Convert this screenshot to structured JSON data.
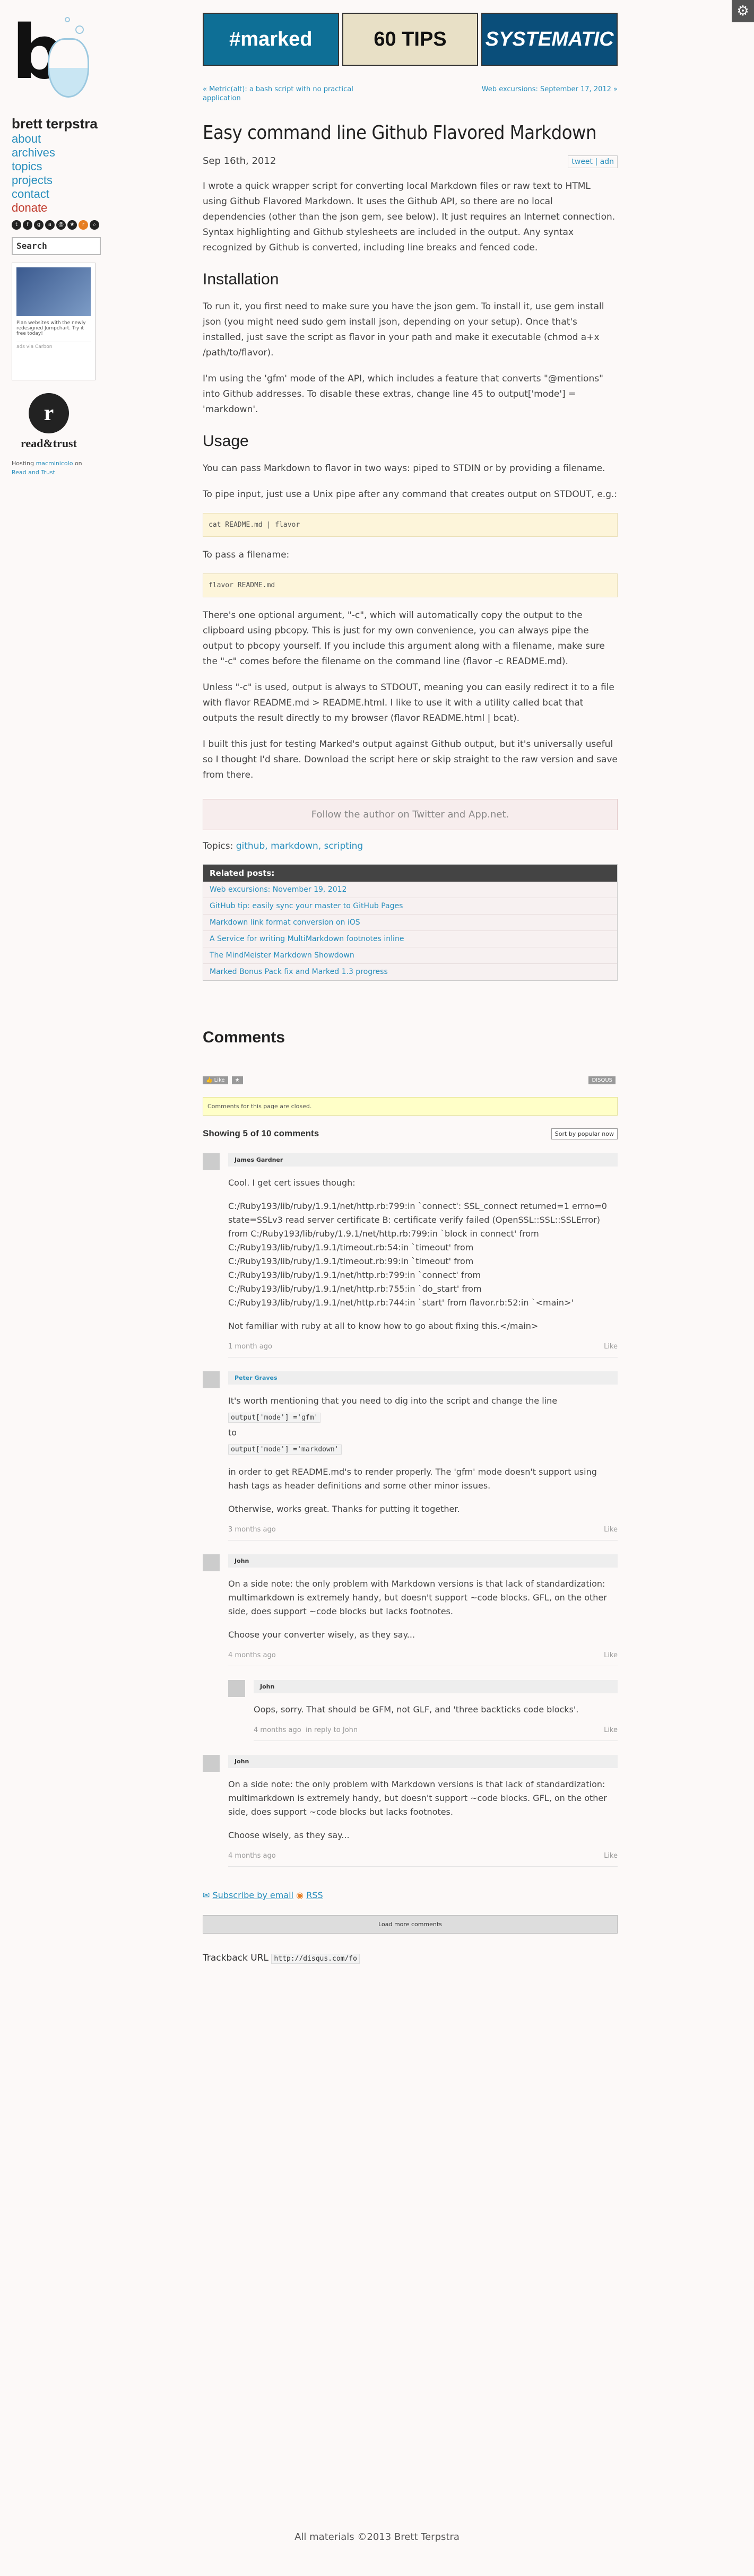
{
  "sidebar": {
    "site_name": "brett terpstra",
    "nav": [
      "about",
      "archives",
      "topics",
      "projects",
      "contact",
      "donate"
    ],
    "search_placeholder": "Search",
    "ad_text": "Plan websites with the newly redesigned Jumpchart. Try it free today!",
    "ad_via": "ads via Carbon",
    "read_trust": "read&trust",
    "hosting_prefix": "Hosting",
    "hosting_link": "macminicolo",
    "hosting_on": "on",
    "read_trust_link": "Read and Trust"
  },
  "banners": [
    "#marked",
    "60 TIPS",
    "SYSTEMATIC"
  ],
  "postnav": {
    "prev": "« Metric(alt): a bash script with no practical application",
    "next": "Web excursions: September 17, 2012 »"
  },
  "post": {
    "title": "Easy command line Github Flavored Markdown",
    "date": "Sep 16th, 2012",
    "share": [
      "tweet",
      "adn"
    ],
    "intro": "I wrote a quick wrapper script for converting local Markdown files or raw text to HTML using Github Flavored Markdown. It uses the Github API, so there are no local dependencies (other than the json gem, see below). It just requires an Internet connection. Syntax highlighting and Github stylesheets are included in the output. Any syntax recognized by Github is converted, including line breaks and fenced code.",
    "h_install": "Installation",
    "install_1": "To run it, you first need to make sure you have the json gem. To install it, use gem install json (you might need sudo gem install json, depending on your setup). Once that's installed, just save the script as flavor in your path and make it executable (chmod a+x /path/to/flavor).",
    "install_2": "I'm using the 'gfm' mode of the API, which includes a feature that converts \"@mentions\" into Github addresses. To disable these extras, change line 45 to output['mode'] = 'markdown'.",
    "h_usage": "Usage",
    "usage_1": "You can pass Markdown to flavor in two ways: piped to STDIN or by providing a filename.",
    "usage_2": "To pipe input, just use a Unix pipe after any command that creates output on STDOUT, e.g.:",
    "code_1": "cat README.md | flavor",
    "usage_3": "To pass a filename:",
    "code_2": "flavor README.md",
    "usage_4": "There's one optional argument, \"-c\", which will automatically copy the output to the clipboard using pbcopy. This is just for my own convenience, you can always pipe the output to pbcopy yourself. If you include this argument along with a filename, make sure the \"-c\" comes before the filename on the command line (flavor -c README.md).",
    "usage_5": "Unless \"-c\" is used, output is always to STDOUT, meaning you can easily redirect it to a file with flavor README.md > README.html. I like to use it with a utility called bcat that outputs the result directly to my browser (flavor README.html | bcat).",
    "usage_6": "I built this just for testing Marked's output against Github output, but it's universally useful so I thought I'd share. Download the script here or skip straight to the raw version and save from there.",
    "follow": "Follow the author on Twitter and App.net.",
    "topics_label": "Topics:",
    "topics": "github, markdown, scripting"
  },
  "related": {
    "title": "Related posts:",
    "items": [
      "Web excursions: November 19, 2012",
      "GitHub tip: easily sync your master to GitHub Pages",
      "Markdown link format conversion on iOS",
      "A Service for writing MultiMarkdown footnotes inline",
      "The MindMeister Markdown Showdown",
      "Marked Bonus Pack fix and Marked 1.3 progress"
    ]
  },
  "comments": {
    "heading": "Comments",
    "like": "Like",
    "disqus": "DISQUS",
    "closed": "Comments for this page are closed.",
    "showing": "Showing 5 of 10 comments",
    "sort": "Sort by popular now",
    "items": [
      {
        "name": "James Gardner",
        "paras": [
          "Cool. I get cert issues though:",
          "C:/Ruby193/lib/ruby/1.9.1/net/http.rb:799:in `connect': SSL_connect returned=1 errno=0 state=SSLv3 read server certificate B: certificate verify failed (OpenSSL::SSL::SSLError) from C:/Ruby193/lib/ruby/1.9.1/net/http.rb:799:in `block in connect' from C:/Ruby193/lib/ruby/1.9.1/timeout.rb:54:in `timeout' from C:/Ruby193/lib/ruby/1.9.1/timeout.rb:99:in `timeout' from C:/Ruby193/lib/ruby/1.9.1/net/http.rb:799:in `connect' from C:/Ruby193/lib/ruby/1.9.1/net/http.rb:755:in `do_start' from C:/Ruby193/lib/ruby/1.9.1/net/http.rb:744:in `start' from flavor.rb:52:in `<main>'",
          "Not familiar with ruby at all to know how to go about fixing this.</main>"
        ],
        "time": "1 month ago"
      },
      {
        "name": "Peter Graves",
        "paras": [
          "It's worth mentioning that you need to dig into the script and change the line",
          "output['mode'] ='gfm'",
          "to",
          "output['mode'] ='markdown'",
          "in order to get README.md's to render properly. The 'gfm' mode doesn't support using hash tags as header definitions and some other minor issues.",
          "Otherwise, works great. Thanks for putting it together."
        ],
        "time": "3 months ago"
      },
      {
        "name": "John",
        "paras": [
          "On a side note: the only problem with Markdown versions is that lack of standardization: multimarkdown is extremely handy, but doesn't support ~code blocks. GFL, on the other side, does support ~code blocks but lacks footnotes.",
          "Choose your converter wisely, as they say..."
        ],
        "time": "4 months ago"
      },
      {
        "name": "John",
        "paras": [
          "Oops, sorry. That should be GFM, not GLF, and 'three backticks code blocks'."
        ],
        "time": "4 months ago",
        "reply": "in reply to John"
      },
      {
        "name": "John",
        "paras": [
          "On a side note: the only problem with Markdown versions is that lack of standardization: multimarkdown is extremely handy, but doesn't support ~code blocks. GFL, on the other side, does support ~code blocks but lacks footnotes.",
          "Choose wisely, as they say..."
        ],
        "time": "4 months ago"
      }
    ],
    "subscribe": "Subscribe by email",
    "rss": "RSS",
    "load_more": "Load more comments",
    "trackback_label": "Trackback URL",
    "trackback_url": "http://disqus.com/fo"
  },
  "footer": "All materials ©2013 Brett Terpstra"
}
